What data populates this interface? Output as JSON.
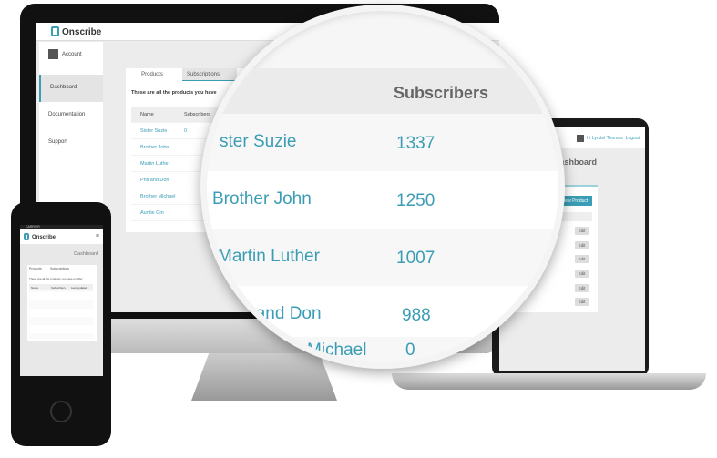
{
  "app": {
    "name": "Onscribe"
  },
  "user": {
    "greeting": "Hi Lyndel Thomas",
    "logout": "Logout"
  },
  "sidebar": {
    "items": [
      {
        "label": "Account"
      },
      {
        "label": "Dashboard"
      },
      {
        "label": "Documentation"
      },
      {
        "label": "Support"
      }
    ]
  },
  "page": {
    "title": "Dashboard",
    "intro": "These are all the products you have",
    "intro_mobile": "These are all the products you have on offer",
    "new_product": "New Product",
    "edit": "Edit"
  },
  "tabs": [
    {
      "label": "Products"
    },
    {
      "label": "Subscriptions"
    }
  ],
  "table": {
    "headers": [
      "Name",
      "Subscribers",
      "Last updated"
    ],
    "rows": [
      {
        "name": "Sister Suzie",
        "subs": "1337",
        "small_subs": "0"
      },
      {
        "name": "Brother John",
        "subs": "1250",
        "small_subs": "0"
      },
      {
        "name": "Martin Luther",
        "subs": "1007"
      },
      {
        "name": "Phil and Don",
        "subs": "988"
      },
      {
        "name": "Brother Michael",
        "subs": "0"
      },
      {
        "name": "Auntie Gin"
      }
    ]
  },
  "lens": {
    "header": "Subscribers",
    "rows": [
      {
        "name": "ster Suzie",
        "subs": "1337"
      },
      {
        "name": "Brother John",
        "subs": "1250"
      },
      {
        "name": "Martin Luther",
        "subs": "1007"
      },
      {
        "name": "il and Don",
        "subs": "988"
      },
      {
        "name": "Michael",
        "subs": "0"
      }
    ]
  },
  "phone": {
    "carrier": "CARRIER"
  },
  "colors": {
    "accent": "#3b9db5"
  }
}
